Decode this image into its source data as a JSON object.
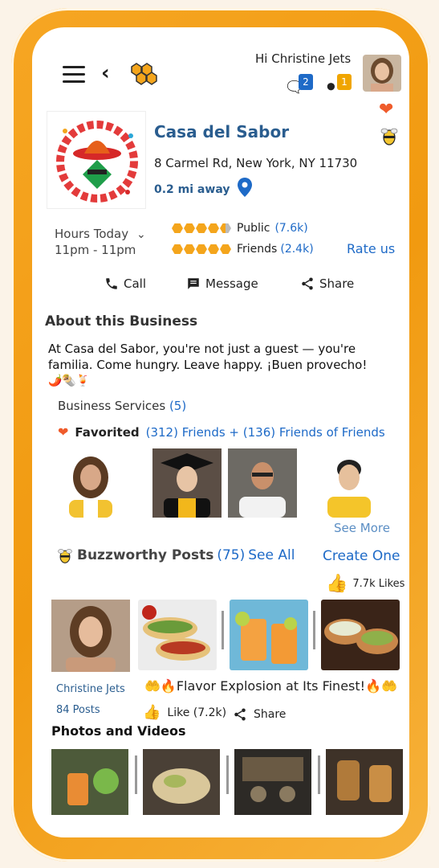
{
  "header": {
    "greeting": "Hi Christine Jets",
    "messages_badge": "2",
    "tags_badge": "1"
  },
  "business": {
    "name": "Casa del Sabor",
    "address": "8 Carmel Rd, New York, NY 11730",
    "distance": "0.2 mi away",
    "hours_label": "Hours Today",
    "hours_value": "11pm - 11pm",
    "public_label": "Public",
    "public_count": "(7.6k)",
    "public_rating": 4.5,
    "friends_label": "Friends",
    "friends_count": "(2.4k)",
    "friends_rating": 5,
    "rate_us": "Rate us"
  },
  "actions": {
    "call": "Call",
    "message": "Message",
    "share": "Share"
  },
  "about": {
    "title": "About this Business",
    "text": "At Casa del Sabor, you're not just a guest — you're familia. Come hungry. Leave happy. ¡Buen provecho!",
    "emojis": "🌶️🌯🍹"
  },
  "services": {
    "label": "Business Services",
    "count": "(5)"
  },
  "favorited": {
    "label": "Favorited",
    "counts": "(312) Friends + (136) Friends of Friends",
    "see_more": "See More"
  },
  "buzz": {
    "title": "Buzzworthy Posts",
    "count": "(75)",
    "see_all": "See All",
    "create": "Create One",
    "likes": "7.7k Likes",
    "poster_name": "Christine Jets",
    "poster_posts": "84 Posts",
    "caption": "🤲🔥Flavor Explosion at Its Finest!🔥🤲",
    "like_label": "Like (7.2k)",
    "share_label": "Share"
  },
  "photos": {
    "title": "Photos and Videos"
  },
  "colors": {
    "accent_blue": "#1e6ac7",
    "brand_orange": "#f4a51c",
    "heart": "#ef5b2b"
  }
}
